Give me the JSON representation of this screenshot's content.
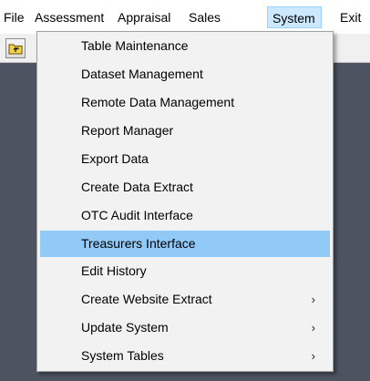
{
  "menubar": {
    "items": [
      "File",
      "Assessment",
      "Appraisal",
      "Sales",
      "System",
      "Exit"
    ],
    "active": "System"
  },
  "toolbar": {
    "icons": [
      "folder-up-icon"
    ]
  },
  "system_menu": {
    "items": [
      {
        "label": "Table Maintenance"
      },
      {
        "label": "Dataset Management"
      },
      {
        "label": "Remote Data Management"
      },
      {
        "label": "Report Manager"
      },
      {
        "label": "Export Data"
      },
      {
        "label": "Create Data Extract"
      },
      {
        "label": "OTC Audit Interface"
      },
      {
        "label": "Treasurers Interface",
        "highlighted": true
      },
      {
        "label": "Edit History"
      },
      {
        "label": "Create Website Extract",
        "submenu": true
      },
      {
        "label": "Update System",
        "submenu": true
      },
      {
        "label": "System Tables",
        "submenu": true
      }
    ],
    "submenu_glyph": "›"
  },
  "colors": {
    "highlight": "#91c9f7",
    "active_menu": "#cce8ff",
    "client_background": "#4d5360"
  }
}
